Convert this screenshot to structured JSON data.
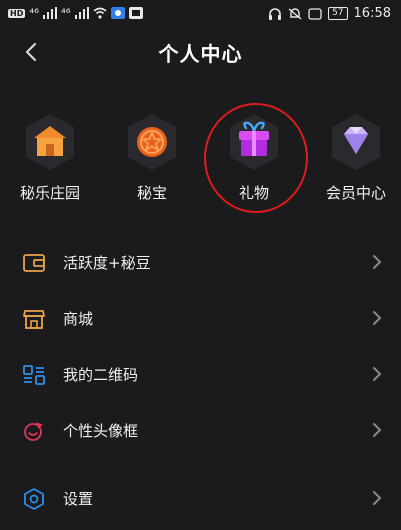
{
  "status_bar": {
    "hd": "HD",
    "signal1": "⁴⁶",
    "signal2": "⁴⁶",
    "battery": "57",
    "time": "16:58"
  },
  "header": {
    "title": "个人中心"
  },
  "entries": [
    {
      "label": "秘乐庄园",
      "icon": "house-icon",
      "color": "#f08a2a"
    },
    {
      "label": "秘宝",
      "icon": "star-coin-icon",
      "color": "#e8621d"
    },
    {
      "label": "礼物",
      "icon": "gift-icon",
      "color": "#c535e8"
    },
    {
      "label": "会员中心",
      "icon": "diamond-icon",
      "color": "#b79cf2"
    }
  ],
  "list": [
    {
      "label": "活跃度+秘豆",
      "icon": "wallet-icon"
    },
    {
      "label": "商城",
      "icon": "shop-icon"
    },
    {
      "label": "我的二维码",
      "icon": "qrcode-icon"
    },
    {
      "label": "个性头像框",
      "icon": "avatar-frame-icon"
    },
    {
      "label": "设置",
      "icon": "settings-icon"
    }
  ],
  "colors": {
    "background": "#1b1b1d",
    "accent_orange": "#e9a34a",
    "accent_blue": "#2f8ee6",
    "highlight": "#e01b1b"
  }
}
